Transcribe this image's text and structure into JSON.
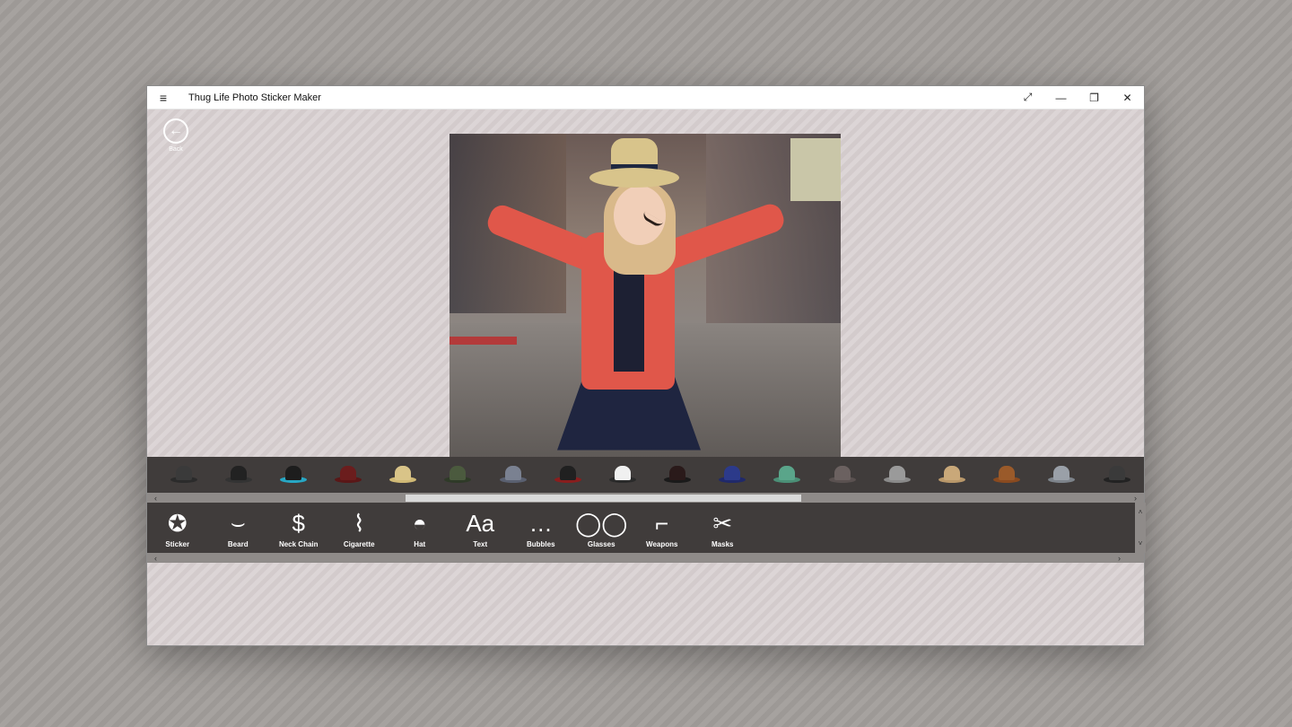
{
  "window": {
    "title": "Thug Life Photo Sticker Maker",
    "controls": {
      "menu": "≡",
      "fullscreen": "⤢",
      "minimize": "—",
      "restore": "❐",
      "close": "✕"
    }
  },
  "back": {
    "label": "Back",
    "icon": "←"
  },
  "sticker_strip": {
    "hats": [
      {
        "crown": "#3a3a3a",
        "brim": "#2b2b2b"
      },
      {
        "crown": "#222222",
        "brim": "#333333"
      },
      {
        "crown": "#1d1d1d",
        "brim": "#27a7c4"
      },
      {
        "crown": "#6b1d1d",
        "brim": "#5a1717"
      },
      {
        "crown": "#d9c488",
        "brim": "#d0b975"
      },
      {
        "crown": "#4b5a3e",
        "brim": "#2f3a28"
      },
      {
        "crown": "#7a8191",
        "brim": "#5a6070"
      },
      {
        "crown": "#202020",
        "brim": "#8a1d1d"
      },
      {
        "crown": "#f0f0f0",
        "brim": "#2a2a2a"
      },
      {
        "crown": "#2a1a1a",
        "brim": "#1a1a1a"
      },
      {
        "crown": "#2c3a8a",
        "brim": "#20296a"
      },
      {
        "crown": "#5aa58a",
        "brim": "#4b8f76"
      },
      {
        "crown": "#6b6160",
        "brim": "#5a5150"
      },
      {
        "crown": "#9a9a9a",
        "brim": "#8a8a8a"
      },
      {
        "crown": "#c9a879",
        "brim": "#b9986a"
      },
      {
        "crown": "#9a5a2a",
        "brim": "#8a4a1f"
      },
      {
        "crown": "#9aa0a8",
        "brim": "#7d838a"
      },
      {
        "crown": "#3a3a3a",
        "brim": "#222222"
      }
    ]
  },
  "scroll": {
    "left": "‹",
    "right": "›",
    "up": "˄",
    "down": "˅"
  },
  "tools": [
    {
      "name": "sticker",
      "label": "Sticker",
      "icon": "✪"
    },
    {
      "name": "beard",
      "label": "Beard",
      "icon": "⌣"
    },
    {
      "name": "neck-chain",
      "label": "Neck Chain",
      "icon": "$"
    },
    {
      "name": "cigarette",
      "label": "Cigarette",
      "icon": "⌇"
    },
    {
      "name": "hat",
      "label": "Hat",
      "icon": "◓"
    },
    {
      "name": "text",
      "label": "Text",
      "icon": "Aa"
    },
    {
      "name": "bubbles",
      "label": "Bubbles",
      "icon": "…"
    },
    {
      "name": "glasses",
      "label": "Glasses",
      "icon": "◯◯"
    },
    {
      "name": "weapons",
      "label": "Weapons",
      "icon": "⌐"
    },
    {
      "name": "masks",
      "label": "Masks",
      "icon": "✂"
    }
  ]
}
